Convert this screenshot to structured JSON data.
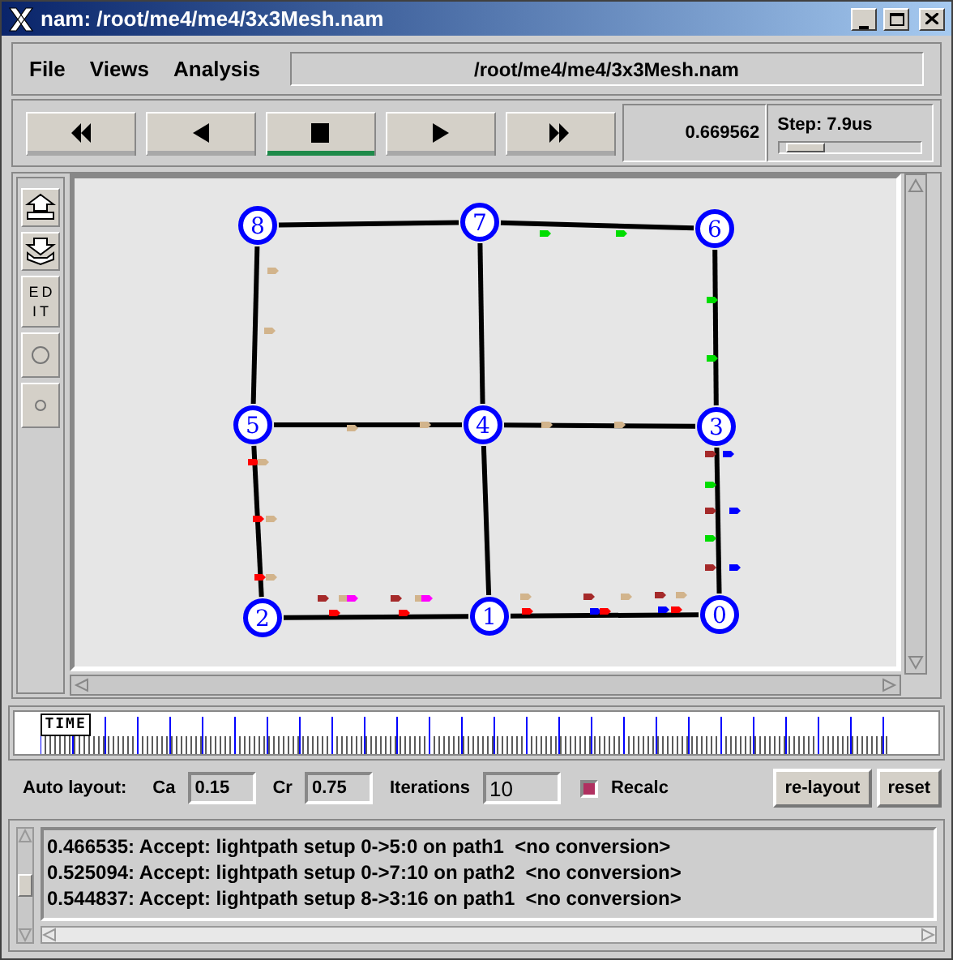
{
  "window": {
    "title": "nam: /root/me4/me4/3x3Mesh.nam"
  },
  "menu": [
    {
      "label": "File"
    },
    {
      "label": "Views"
    },
    {
      "label": "Analysis"
    }
  ],
  "file_path": "/root/me4/me4/3x3Mesh.nam",
  "playback": [
    {
      "kind": "rewind",
      "selected": false
    },
    {
      "kind": "back",
      "selected": false
    },
    {
      "kind": "stop",
      "selected": true
    },
    {
      "kind": "play",
      "selected": false
    },
    {
      "kind": "forward",
      "selected": false
    }
  ],
  "time": "0.669562",
  "step": {
    "label": "Step: 7.9us",
    "level": 0.19
  },
  "tools": [
    {
      "kind": "zoom-in"
    },
    {
      "kind": "zoom-out"
    },
    {
      "kind": "edit",
      "label": "EDIT"
    },
    {
      "kind": "big-circle"
    },
    {
      "kind": "small-circle"
    }
  ],
  "nodes": [
    {
      "label": "8"
    },
    {
      "label": "7"
    },
    {
      "label": "6"
    },
    {
      "label": "5"
    },
    {
      "label": "4"
    },
    {
      "label": "3"
    },
    {
      "label": "2"
    },
    {
      "label": "1"
    },
    {
      "label": "0"
    }
  ],
  "timeline": {
    "label": "TIME",
    "level": 0.03
  },
  "auto_layout": {
    "label": "Auto layout:",
    "fields": [
      {
        "label": "Ca",
        "value": "0.15"
      },
      {
        "label": "Cr",
        "value": "0.75"
      },
      {
        "label": "Iterations",
        "value": "10"
      }
    ],
    "recalc": {
      "label": "Recalc",
      "checked": true
    },
    "buttons": [
      "re-layout",
      "reset"
    ]
  },
  "log": [
    "0.466535: Accept: lightpath setup 0->5:0 on path1  <no conversion>",
    "0.525094: Accept: lightpath setup 0->7:10 on path2  <no conversion>",
    "0.544837: Accept: lightpath setup 8->3:16 on path1  <no conversion>"
  ]
}
